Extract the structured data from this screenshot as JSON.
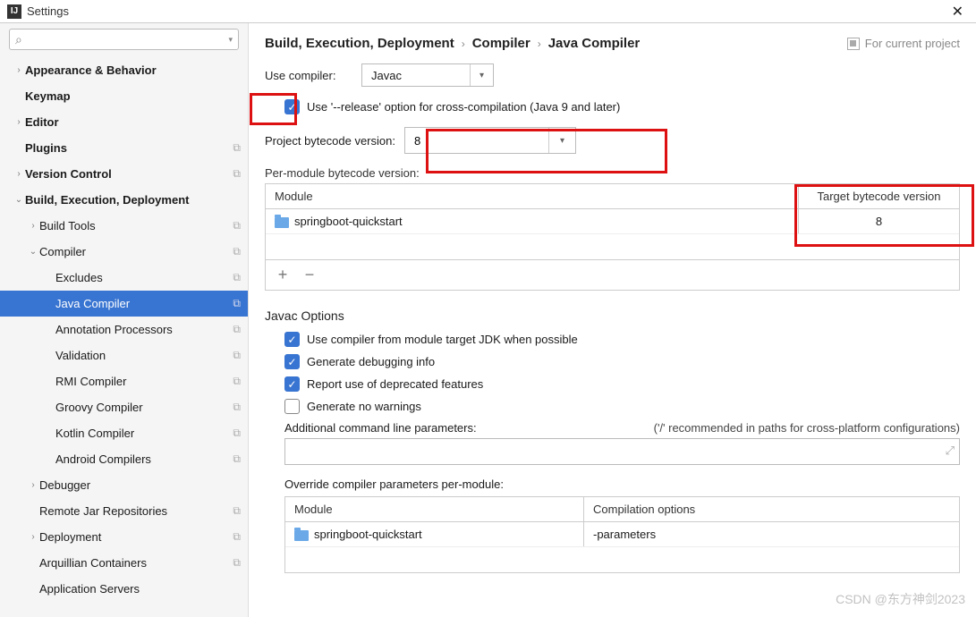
{
  "window": {
    "title": "Settings"
  },
  "search": {
    "placeholder": ""
  },
  "sidebar": {
    "items": [
      {
        "label": "Appearance & Behavior",
        "bold": true,
        "chevron": "right",
        "indent": 0
      },
      {
        "label": "Keymap",
        "bold": true,
        "chevron": "",
        "indent": 0
      },
      {
        "label": "Editor",
        "bold": true,
        "chevron": "right",
        "indent": 0
      },
      {
        "label": "Plugins",
        "bold": true,
        "chevron": "",
        "indent": 0,
        "copy": true
      },
      {
        "label": "Version Control",
        "bold": true,
        "chevron": "right",
        "indent": 0,
        "copy": true
      },
      {
        "label": "Build, Execution, Deployment",
        "bold": true,
        "chevron": "down",
        "indent": 0
      },
      {
        "label": "Build Tools",
        "bold": false,
        "chevron": "right",
        "indent": 1,
        "copy": true
      },
      {
        "label": "Compiler",
        "bold": false,
        "chevron": "down",
        "indent": 1,
        "copy": true
      },
      {
        "label": "Excludes",
        "bold": false,
        "chevron": "",
        "indent": 2,
        "copy": true
      },
      {
        "label": "Java Compiler",
        "bold": false,
        "chevron": "",
        "indent": 2,
        "copy": true,
        "selected": true
      },
      {
        "label": "Annotation Processors",
        "bold": false,
        "chevron": "",
        "indent": 2,
        "copy": true
      },
      {
        "label": "Validation",
        "bold": false,
        "chevron": "",
        "indent": 2,
        "copy": true
      },
      {
        "label": "RMI Compiler",
        "bold": false,
        "chevron": "",
        "indent": 2,
        "copy": true
      },
      {
        "label": "Groovy Compiler",
        "bold": false,
        "chevron": "",
        "indent": 2,
        "copy": true
      },
      {
        "label": "Kotlin Compiler",
        "bold": false,
        "chevron": "",
        "indent": 2,
        "copy": true
      },
      {
        "label": "Android Compilers",
        "bold": false,
        "chevron": "",
        "indent": 2,
        "copy": true
      },
      {
        "label": "Debugger",
        "bold": false,
        "chevron": "right",
        "indent": 1
      },
      {
        "label": "Remote Jar Repositories",
        "bold": false,
        "chevron": "",
        "indent": 1,
        "copy": true
      },
      {
        "label": "Deployment",
        "bold": false,
        "chevron": "right",
        "indent": 1,
        "copy": true
      },
      {
        "label": "Arquillian Containers",
        "bold": false,
        "chevron": "",
        "indent": 1,
        "copy": true
      },
      {
        "label": "Application Servers",
        "bold": false,
        "chevron": "",
        "indent": 1
      }
    ]
  },
  "breadcrumbs": {
    "c1": "Build, Execution, Deployment",
    "c2": "Compiler",
    "c3": "Java Compiler",
    "scope": "For current project"
  },
  "compiler": {
    "use_compiler_label": "Use compiler:",
    "use_compiler_value": "Javac",
    "release_option": "Use '--release' option for cross-compilation (Java 9 and later)",
    "proj_bytecode_label": "Project bytecode version:",
    "proj_bytecode_value": "8",
    "per_module_label": "Per-module bytecode version:",
    "table": {
      "h_module": "Module",
      "h_target": "Target bytecode version",
      "rows": [
        {
          "module": "springboot-quickstart",
          "target": "8"
        }
      ]
    }
  },
  "javac": {
    "title": "Javac Options",
    "opt1": "Use compiler from module target JDK when possible",
    "opt2": "Generate debugging info",
    "opt3": "Report use of deprecated features",
    "opt4": "Generate no warnings",
    "params_label": "Additional command line parameters:",
    "params_hint": "('/' recommended in paths for cross-platform configurations)",
    "params_value": "",
    "override_label": "Override compiler parameters per-module:",
    "override_table": {
      "h_module": "Module",
      "h_opts": "Compilation options",
      "rows": [
        {
          "module": "springboot-quickstart",
          "opts": "-parameters"
        }
      ]
    }
  },
  "watermark": "CSDN @东方神剑2023"
}
